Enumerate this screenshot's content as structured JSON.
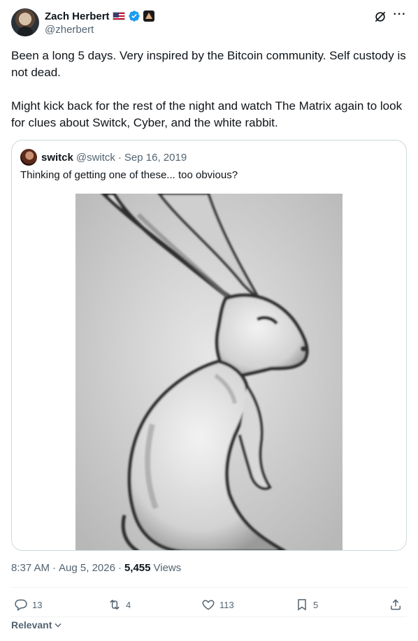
{
  "author": {
    "name": "Zach Herbert",
    "handle": "@zherbert",
    "icons": [
      "us-flag-icon",
      "verified-badge-icon",
      "affiliate-badge-icon"
    ]
  },
  "header_icons": [
    "grok-icon",
    "more-icon"
  ],
  "tweet": {
    "paragraphs": [
      "Been a long 5 days. Very inspired by the Bitcoin community. Self custody is not dead.",
      "Might kick back for the rest of the night and watch The Matrix again to look for clues about Switck, Cyber, and the white rabbit."
    ]
  },
  "quote": {
    "name": "switck",
    "handle": "@switck",
    "date": "Sep 16, 2019",
    "text": "Thinking of getting one of these... too obvious?",
    "image": "white-rabbit-sketch"
  },
  "meta": {
    "time": "8:37 AM",
    "date": "Aug 5, 2026",
    "views_count": "5,455",
    "views_label": "Views"
  },
  "actions": {
    "replies": "13",
    "reposts": "4",
    "likes": "113",
    "bookmarks": "5"
  },
  "sort": {
    "label": "Relevant"
  },
  "colors": {
    "text": "#0f1419",
    "secondary": "#536471",
    "border": "#cfd9de",
    "verified": "#1d9bf0"
  }
}
